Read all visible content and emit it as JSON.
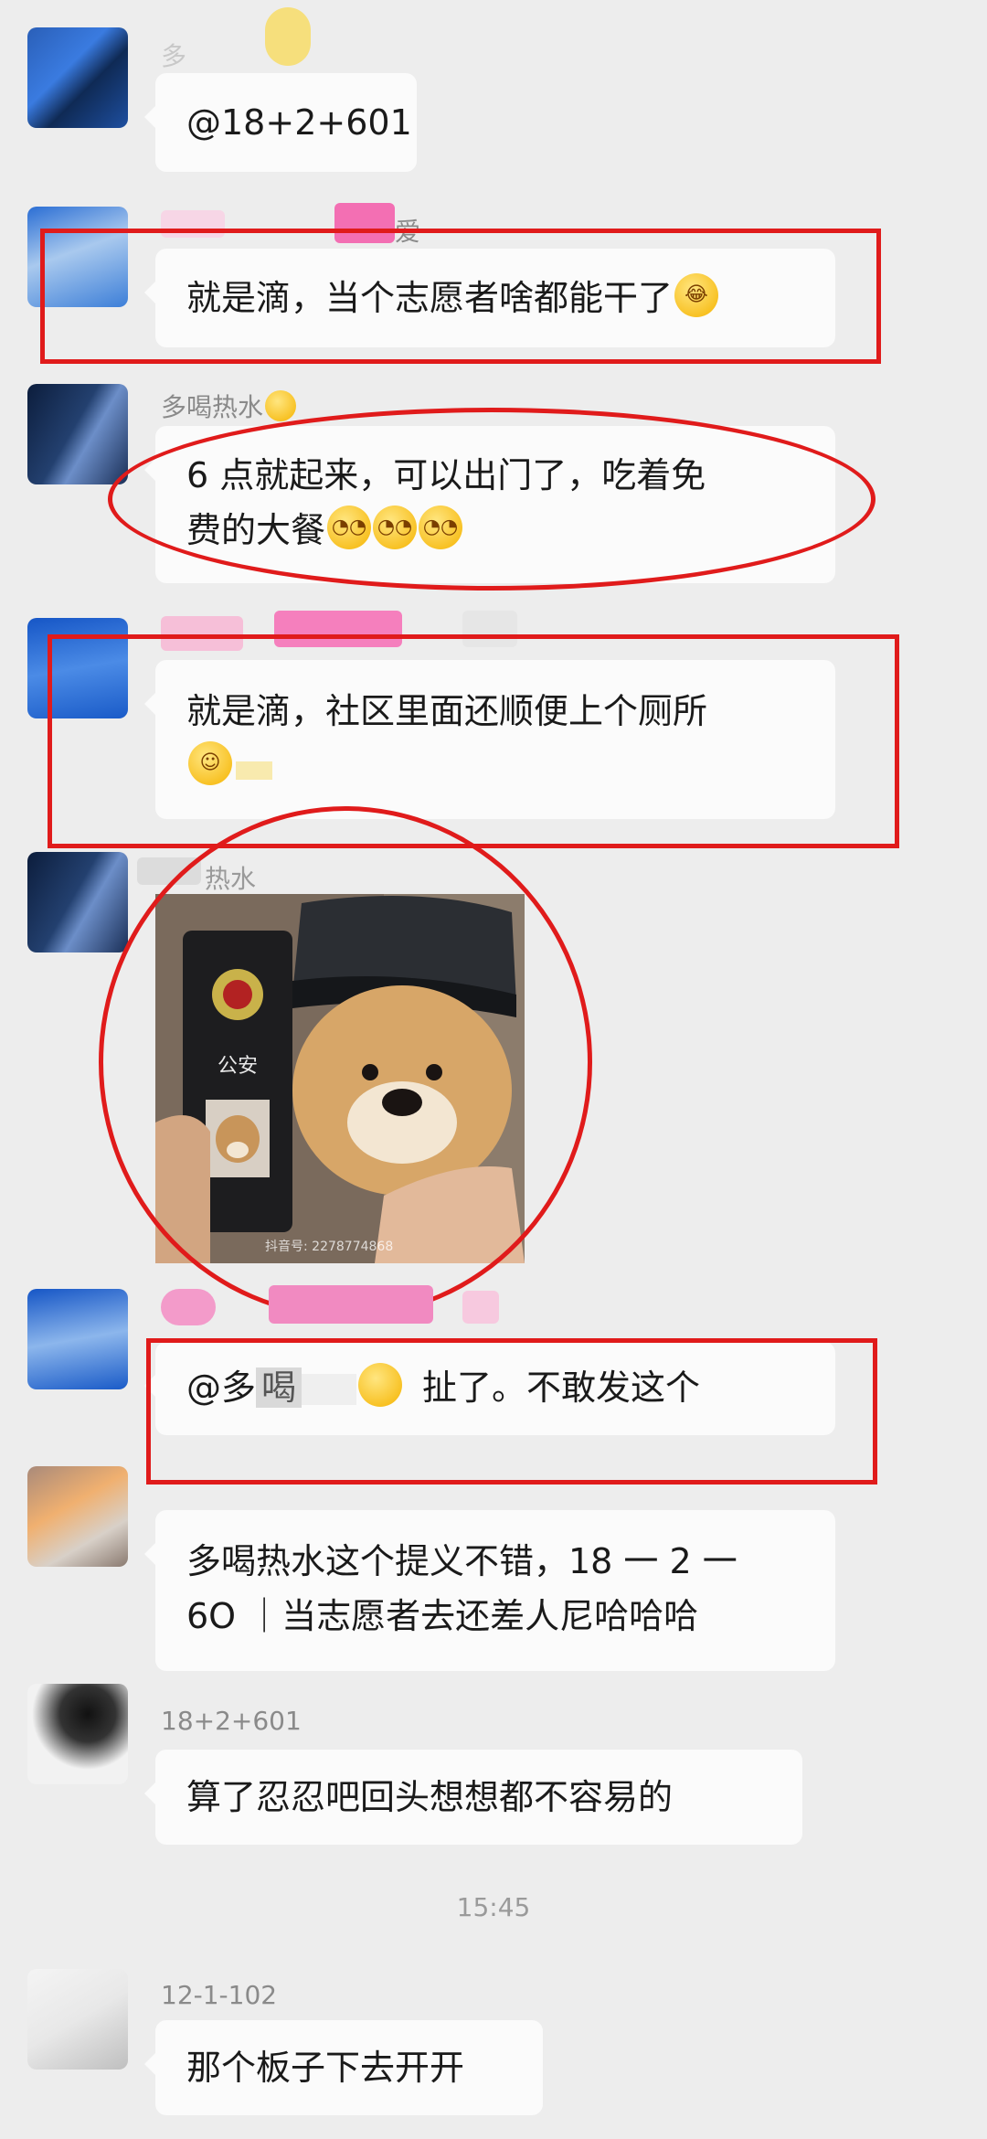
{
  "messages": [
    {
      "id": "m1",
      "sender": "多",
      "text": "@18+2+601"
    },
    {
      "id": "m2",
      "sender": "爱",
      "text": "就是滴，当个志愿者啥都能干了"
    },
    {
      "id": "m3",
      "sender": "多喝热水",
      "text_line1": "6 点就起来，可以出门了，吃着免",
      "text_line2": "费的大餐"
    },
    {
      "id": "m4",
      "sender": "",
      "text": "就是滴，社区里面还顺便上个厕所"
    },
    {
      "id": "m5",
      "sender": "热水",
      "image": {
        "badge_text": "公安",
        "watermark": "抖音号: 2278774868"
      }
    },
    {
      "id": "m6",
      "sender": "",
      "mention": "@多",
      "mention_2": "喝",
      "text": "扯了。不敢发这个"
    },
    {
      "id": "m7",
      "sender": "",
      "text_line1": "多喝热水这个提义不错，18 一 2 一",
      "text_line2": "6O ｜当志愿者去还差人尼哈哈哈"
    },
    {
      "id": "m8",
      "sender": "18+2+601",
      "text": "算了忍忍吧回头想想都不容易的"
    },
    {
      "id": "m9",
      "sender": "12-1-102",
      "text": "那个板子下去开开"
    }
  ],
  "timestamp": "15:45",
  "colors": {
    "annotation": "#e01b1b",
    "bubble": "#fbfbfb",
    "background": "#ededed"
  }
}
